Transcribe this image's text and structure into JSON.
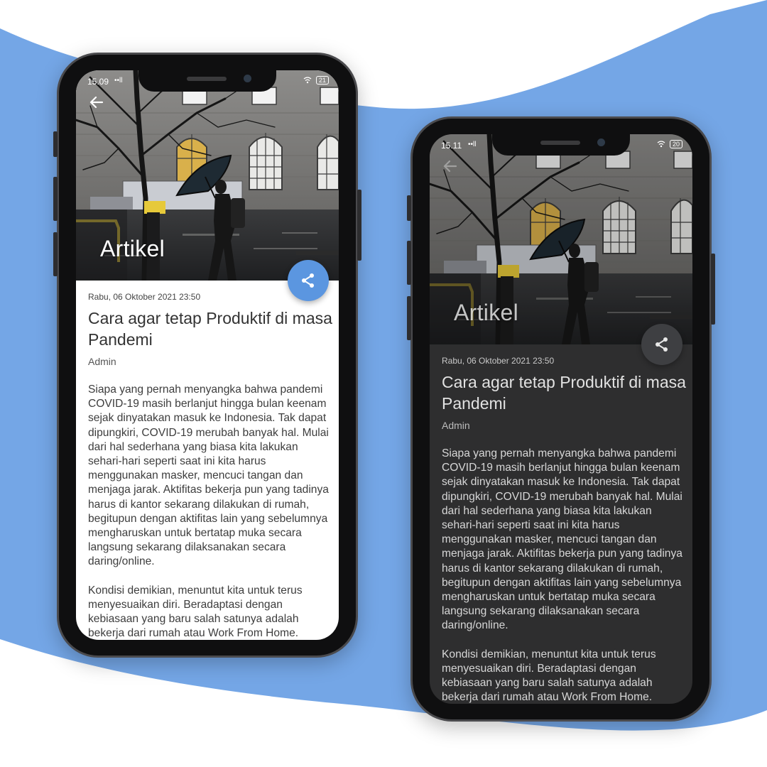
{
  "colors": {
    "accent_blue": "#5b96e0",
    "background_wave": "#74a6e6",
    "dark_surface": "#2e2e2f"
  },
  "light_screen": {
    "status": {
      "time": "15.09",
      "signal": "••ll",
      "battery": "21"
    },
    "header_title": "Artikel",
    "article": {
      "date": "Rabu, 06 Oktober 2021 23:50",
      "title": "Cara agar tetap Produktif di masa Pandemi",
      "author": "Admin",
      "paragraph1": "Siapa yang pernah menyangka bahwa pandemi COVID-19 masih berlanjut hingga bulan keenam sejak dinyatakan masuk ke Indonesia. Tak dapat dipungkiri, COVID-19 merubah banyak hal. Mulai dari hal sederhana yang biasa kita lakukan sehari-hari seperti saat ini kita harus menggunakan masker, mencuci tangan dan menjaga jarak. Aktifitas bekerja pun yang tadinya harus di kantor sekarang dilakukan di rumah, begitupun dengan aktifitas lain yang sebelumnya mengharuskan untuk bertatap muka secara langsung sekarang dilaksanakan secara daring/online.",
      "paragraph2": "Kondisi demikian, menuntut kita untuk terus menyesuaikan diri. Beradaptasi dengan kebiasaan yang baru salah satunya adalah bekerja dari rumah atau Work From Home."
    },
    "icons": {
      "back": "back-arrow-icon",
      "share": "share-icon"
    }
  },
  "dark_screen": {
    "status": {
      "time": "15.11",
      "signal": "••ll",
      "battery": "20"
    },
    "header_title": "Artikel",
    "article": {
      "date": "Rabu, 06 Oktober 2021 23:50",
      "title": "Cara agar tetap Produktif di masa Pandemi",
      "author": "Admin",
      "paragraph1": "Siapa yang pernah menyangka bahwa pandemi COVID-19 masih berlanjut hingga bulan keenam sejak dinyatakan masuk ke Indonesia. Tak dapat dipungkiri, COVID-19 merubah banyak hal. Mulai dari hal sederhana yang biasa kita lakukan sehari-hari seperti saat ini kita harus menggunakan masker, mencuci tangan dan menjaga jarak. Aktifitas bekerja pun yang tadinya harus di kantor sekarang dilakukan di rumah, begitupun dengan aktifitas lain yang sebelumnya mengharuskan untuk bertatap muka secara langsung sekarang dilaksanakan secara daring/online.",
      "paragraph2": "Kondisi demikian, menuntut kita untuk terus menyesuaikan diri. Beradaptasi dengan kebiasaan yang baru salah satunya adalah bekerja dari rumah atau Work From Home."
    },
    "icons": {
      "back": "back-arrow-icon",
      "share": "share-icon"
    }
  }
}
